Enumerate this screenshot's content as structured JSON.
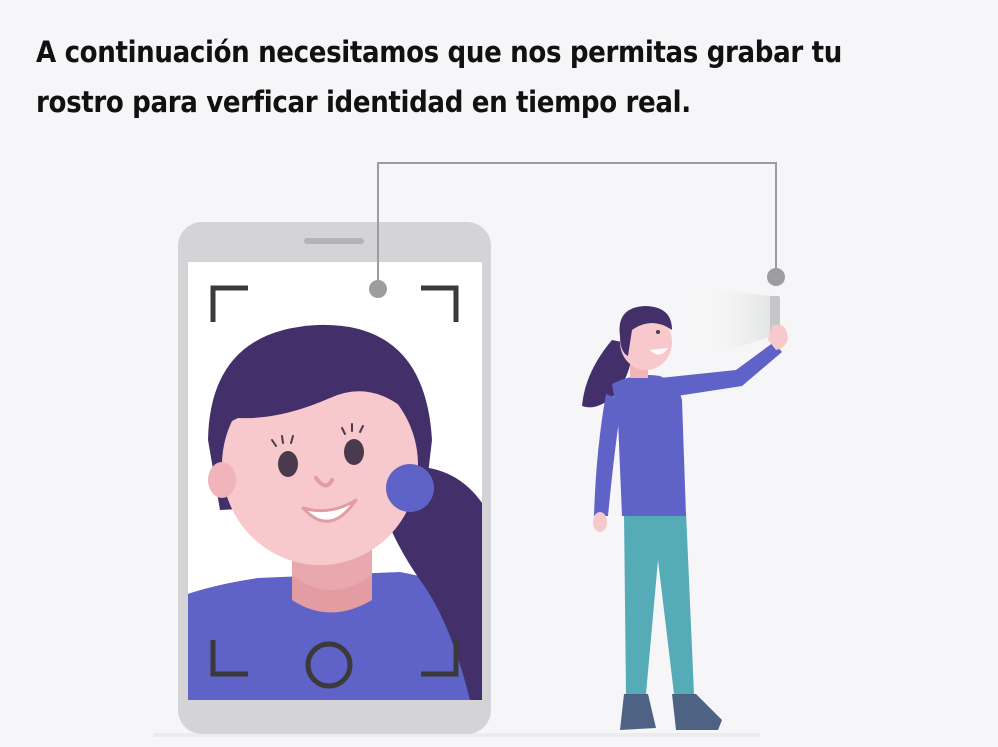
{
  "instruction": {
    "text": "A continuación necesitamos que nos permitas grabar tu rostro para verficar identidad en tiempo real."
  },
  "colors": {
    "background": "#f6f6f8",
    "phone_body": "#d4d4d6",
    "hair": "#43306a",
    "skin": "#f7c9cc",
    "shirt": "#5f62c6",
    "pants": "#55abb6",
    "shoes": "#4e6384",
    "connector": "#9d9d9f",
    "frame_corners": "#3a3a3a"
  },
  "icons": {
    "capture_button": "circle-shutter-icon",
    "camera_frame": "viewfinder-corners-icon"
  }
}
